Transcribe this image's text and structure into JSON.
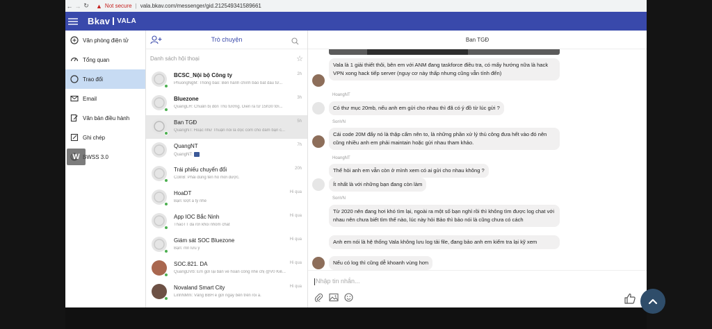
{
  "browser": {
    "back": "←",
    "forward": "→",
    "reload": "↻",
    "security_label": "Not secure",
    "url": "vala.bkav.com/messenger/gid.212549341589661"
  },
  "app": {
    "logo_main": "Bkav",
    "logo_sub": "VALA",
    "accent_color": "#3949ab"
  },
  "sidebar": {
    "items": [
      {
        "label": "Văn phòng điện tử",
        "icon": "building-icon"
      },
      {
        "label": "Tổng quan",
        "icon": "dashboard-icon"
      },
      {
        "label": "Trao đổi",
        "icon": "chat-icon"
      },
      {
        "label": "Email",
        "icon": "email-icon"
      },
      {
        "label": "Văn bản điều hành",
        "icon": "document-icon"
      },
      {
        "label": "Ghi chép",
        "icon": "note-icon"
      },
      {
        "label": "BWSS 3.0",
        "icon": "globe-icon"
      }
    ],
    "overlay_label": "W"
  },
  "conversations": {
    "tab_label": "Trò chuyện",
    "list_title": "Danh sách hội thoại",
    "items": [
      {
        "name": "BCSC_Nội bộ Công ty",
        "preview": "PhuongNgM: Thông báo: Bên hành chính bảo bắt đầu từ...",
        "time": "2h"
      },
      {
        "name": "Bluezone",
        "preview": "QuangLH: Chuẩn bị đón Thủ tướng. Diễn ra từ 15h30 tới...",
        "time": "3h"
      },
      {
        "name": "Ban TGĐ",
        "preview": "QuangNT: Hoặc như Thuận nói là đọc com chỗ đám bạn c...",
        "time": "5h"
      },
      {
        "name": "QuangNT",
        "preview": "QuangNT:",
        "time": "7h"
      },
      {
        "name": "Trái phiếu chuyển đổi",
        "preview": "ColnB: Phải đúng tên hồ mới được.",
        "time": "20h"
      },
      {
        "name": "HoaDT",
        "preview": "Bạn: Đợt a tý nhé",
        "time": "Hi qua"
      },
      {
        "name": "App IOC Bắc Ninh",
        "preview": "ThaoTT đã rời khỏi nhóm chat",
        "time": "Hi qua"
      },
      {
        "name": "Giám sát SOC Bluezone",
        "preview": "Bạn: mn lưu ý",
        "time": "Hi qua"
      },
      {
        "name": "SOC.821. DA",
        "preview": "QuangDVb: Em gửi lại bản về hoàn công nhé chị @V0 Kiể...",
        "time": "Hi qua"
      },
      {
        "name": "Novaland Smart City",
        "preview": "LinhNMm: Vâng BBH e gửi ngay bên trên rồi a.",
        "time": "Hi qua"
      }
    ]
  },
  "chat": {
    "title": "Ban TGĐ",
    "messages": [
      {
        "sender": "",
        "text": "Vala là 1 giải thiết thôi, bên em với ANM đang taskforce điều tra, có mấy hướng nữa là hack VPN xong hack tiếp server (nguy cơ này thấp nhưng cũng vẫn tính đến)"
      },
      {
        "sender": "HoangNT",
        "text": "Có thư mục 20mb, nếu anh em  gửi cho nhau thì đã có ý đồ từ lúc gửi ?"
      },
      {
        "sender": "SonVN",
        "text": "Cái code 20M đấy nó là thập cẩm nên to, là những phần xử lý thủ công đưa hết vào đó nên cũng nhiều anh em phải maintain hoặc gửi nhau tham khảo."
      },
      {
        "sender": "HoangNT",
        "text": "Thế hỏi anh em vẫn còn ở mình xem có ai gửi cho nhau không ?"
      },
      {
        "sender": "",
        "text": "Ít nhất là với những bạn đang còn làm"
      },
      {
        "sender": "SonVN",
        "text": "Từ 2020 nên đang hơi khó tìm lại, ngoài ra một số bạn nghỉ rồi thì không tìm được log chat với nhau nên chưa biết tìm thế nào, lúc này hỏi Bảo thì bảo nói là cũng chưa có cách"
      },
      {
        "sender": "",
        "text": "Anh em nói là hệ thống Vala không lưu log tải file, đang bảo anh em kiểm tra lại kỹ xem"
      },
      {
        "sender": "",
        "text": "Nếu có log thì cũng dễ khoanh vùng hơn"
      }
    ],
    "composer_placeholder": "Nhập tin nhắn..."
  }
}
